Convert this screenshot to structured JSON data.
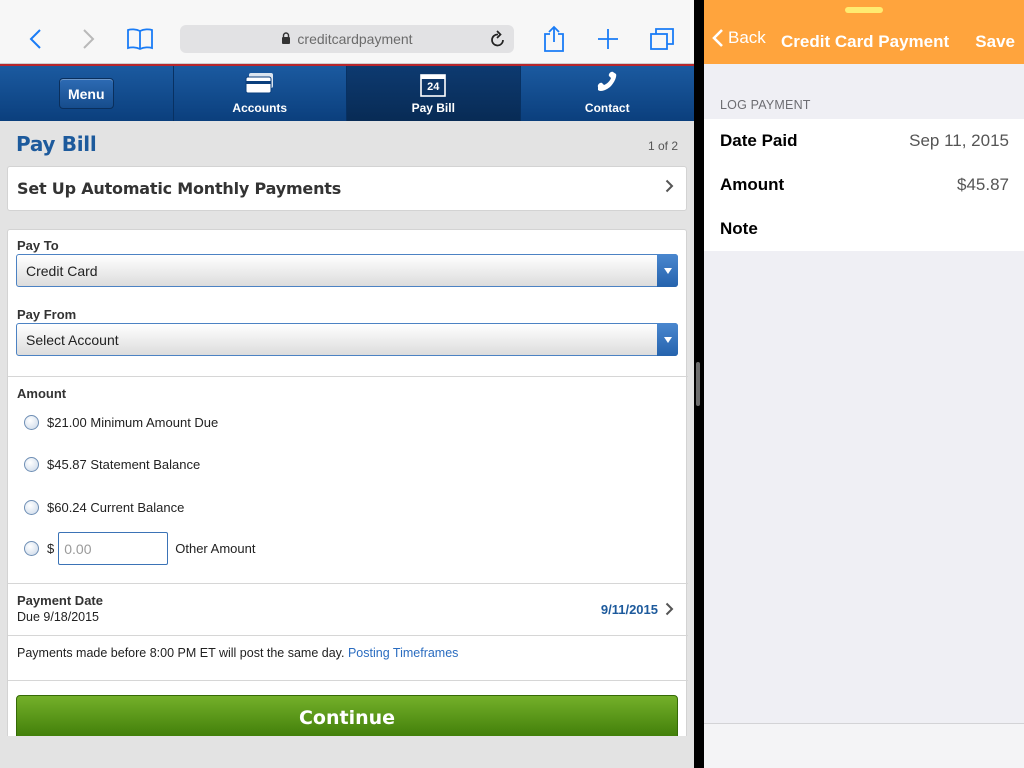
{
  "safari": {
    "url": "creditcardpayment"
  },
  "site_nav": {
    "menu_label": "Menu",
    "items": [
      {
        "label": "Accounts"
      },
      {
        "label": "Pay Bill",
        "icon_text": "24"
      },
      {
        "label": "Contact"
      }
    ]
  },
  "page": {
    "title": "Pay Bill",
    "step": "1 of 2",
    "auto_pay_label": "Set Up Automatic Monthly Payments"
  },
  "form": {
    "pay_to_label": "Pay To",
    "pay_to_value": "Credit Card",
    "pay_from_label": "Pay From",
    "pay_from_value": "Select Account",
    "amount_label": "Amount",
    "options": [
      {
        "amount": "$21.00",
        "desc": "Minimum Amount Due"
      },
      {
        "amount": "$45.87",
        "desc": "Statement Balance"
      },
      {
        "amount": "$60.24",
        "desc": "Current Balance"
      }
    ],
    "other_currency": "$",
    "other_placeholder": "0.00",
    "other_label": "Other Amount",
    "payment_date_label": "Payment Date",
    "due_text": "Due 9/18/2015",
    "payment_date_value": "9/11/2015",
    "posting_note": "Payments made before 8:00 PM ET will post the same day.",
    "posting_link": "Posting Timeframes",
    "continue_label": "Continue"
  },
  "app": {
    "back_label": "Back",
    "title": "Credit Card Payment",
    "save_label": "Save",
    "section_header": "LOG PAYMENT",
    "rows": [
      {
        "label": "Date Paid",
        "value": "Sep 11, 2015"
      },
      {
        "label": "Amount",
        "value": "$45.87"
      },
      {
        "label": "Note",
        "value": ""
      }
    ]
  },
  "colors": {
    "site_blue": "#0b3f7d",
    "accent_orange": "#ffa43d",
    "continue_green": "#4a8a10",
    "link_blue": "#2a6cc0"
  }
}
